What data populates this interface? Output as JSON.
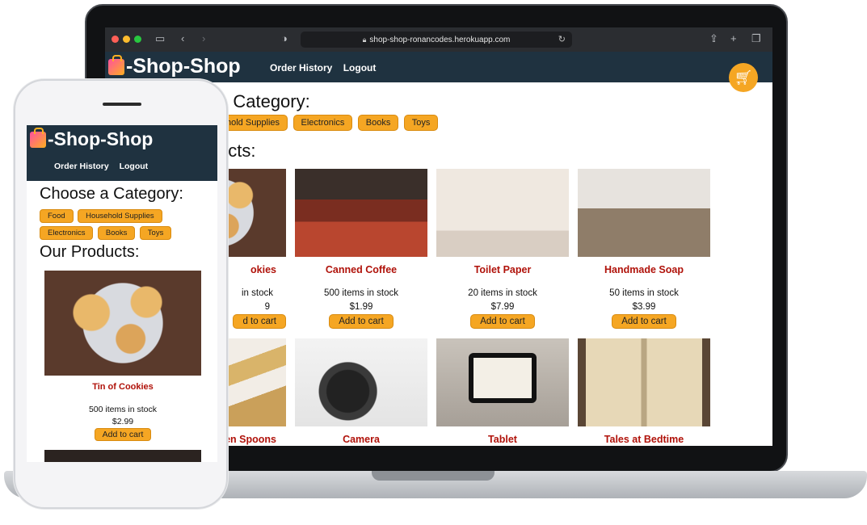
{
  "browser": {
    "url": "shop-shop-ronancodes.herokuapp.com"
  },
  "site": {
    "logo_text": "-Shop-Shop",
    "nav": [
      "Order History",
      "Logout"
    ]
  },
  "laptop": {
    "category_heading": "Choose a Category:",
    "categories": [
      "Food",
      "Household Supplies",
      "Electronics",
      "Books",
      "Toys"
    ],
    "products_heading": "Our Products:",
    "products": [
      {
        "name": "Tin of Cookies",
        "stock": "500 items in stock",
        "price": "$2.99",
        "button": "Add to cart"
      },
      {
        "name": "Canned Coffee",
        "stock": "500 items in stock",
        "price": "$1.99",
        "button": "Add to cart"
      },
      {
        "name": "Toilet Paper",
        "stock": "20 items in stock",
        "price": "$7.99",
        "button": "Add to cart"
      },
      {
        "name": "Handmade Soap",
        "stock": "50 items in stock",
        "price": "$3.99",
        "button": "Add to cart"
      },
      {
        "name": "Wooden Spoons"
      },
      {
        "name": "Camera"
      },
      {
        "name": "Tablet"
      },
      {
        "name": "Tales at Bedtime"
      }
    ],
    "visible": {
      "category_heading": "n Category:",
      "household_partial": "hold Supplies",
      "products_heading": "ucts:",
      "cookies_name": "okies",
      "cookies_stock": "in stock",
      "cookies_price": "9",
      "cookies_button": "d to cart",
      "spoons_name": "en Spoons"
    }
  },
  "phone": {
    "category_heading": "Choose a Category:",
    "categories": [
      "Food",
      "Household Supplies",
      "Electronics",
      "Books",
      "Toys"
    ],
    "products_heading": "Our Products:",
    "product": {
      "name": "Tin of Cookies",
      "stock": "500 items in stock",
      "price": "$2.99",
      "button": "Add to cart"
    }
  },
  "icons": {
    "cart": "shopping-cart-icon",
    "bag": "shopping-bag-icon",
    "lock": "lock-icon",
    "reload": "reload-icon"
  },
  "colors": {
    "header": "#1f3240",
    "accent": "#f5a623",
    "product_name": "#b0120a"
  }
}
